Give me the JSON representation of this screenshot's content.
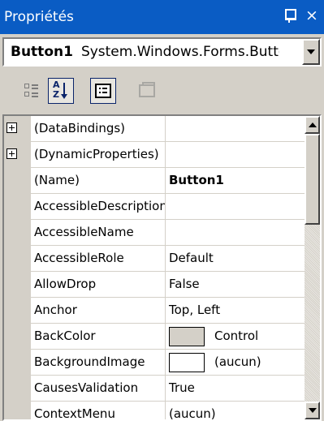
{
  "window": {
    "title": "Propriétés",
    "pin_glyph": "pin-icon",
    "close_glyph": "×"
  },
  "object_selector": {
    "name": "Button1",
    "type": "System.Windows.Forms.Button"
  },
  "toolbar": {
    "categorized": "categorized-icon",
    "alphabetical": "alphabetical-icon",
    "properties": "properties-icon",
    "property_pages": "property-pages-icon"
  },
  "grid": {
    "rows": [
      {
        "name": "(DataBindings)",
        "value": "",
        "expandable": true
      },
      {
        "name": "(DynamicProperties)",
        "value": "",
        "expandable": true
      },
      {
        "name": "(Name)",
        "value": "Button1",
        "bold": true
      },
      {
        "name": "AccessibleDescription",
        "value": ""
      },
      {
        "name": "AccessibleName",
        "value": ""
      },
      {
        "name": "AccessibleRole",
        "value": "Default"
      },
      {
        "name": "AllowDrop",
        "value": "False"
      },
      {
        "name": "Anchor",
        "value": "Top, Left"
      },
      {
        "name": "BackColor",
        "value": "Control",
        "swatch": "#d4d0c8"
      },
      {
        "name": "BackgroundImage",
        "value": "(aucun)",
        "swatch": "#ffffff"
      },
      {
        "name": "CausesValidation",
        "value": "True"
      },
      {
        "name": "ContextMenu",
        "value": "(aucun)"
      }
    ]
  },
  "colors": {
    "titlebar": "#0a5cc4",
    "face": "#d4d0c8"
  }
}
